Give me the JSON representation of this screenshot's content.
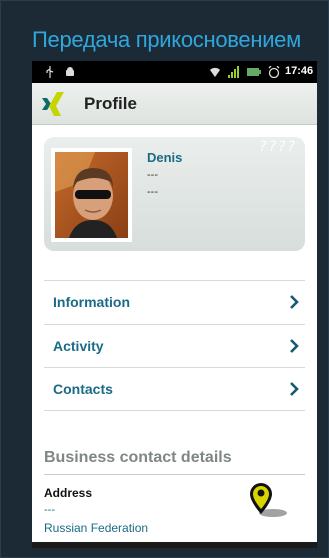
{
  "caption": "Передача прикосновением",
  "status_bar": {
    "time": "17:46",
    "icons": [
      "usb-icon",
      "android-icon",
      "wifi-icon",
      "signal-icon",
      "battery-icon",
      "alarm-clock-icon"
    ]
  },
  "header": {
    "title": "Profile",
    "logo": "xing-logo-icon"
  },
  "profile": {
    "name": "Denis",
    "line1": "---",
    "line2": "---",
    "watermark": "????"
  },
  "nav": {
    "items": [
      {
        "label": "Information"
      },
      {
        "label": "Activity"
      },
      {
        "label": "Contacts"
      }
    ],
    "chevron_icon": "chevron-right-icon"
  },
  "business": {
    "title": "Business contact details",
    "address_label": "Address",
    "address_line": "---",
    "country": "Russian Federation",
    "map_icon": "map-pin-icon"
  },
  "colors": {
    "caption": "#2fa7dc",
    "link": "#1b6b86",
    "accent_green": "#c6d400",
    "section_gray": "#7f8785"
  }
}
